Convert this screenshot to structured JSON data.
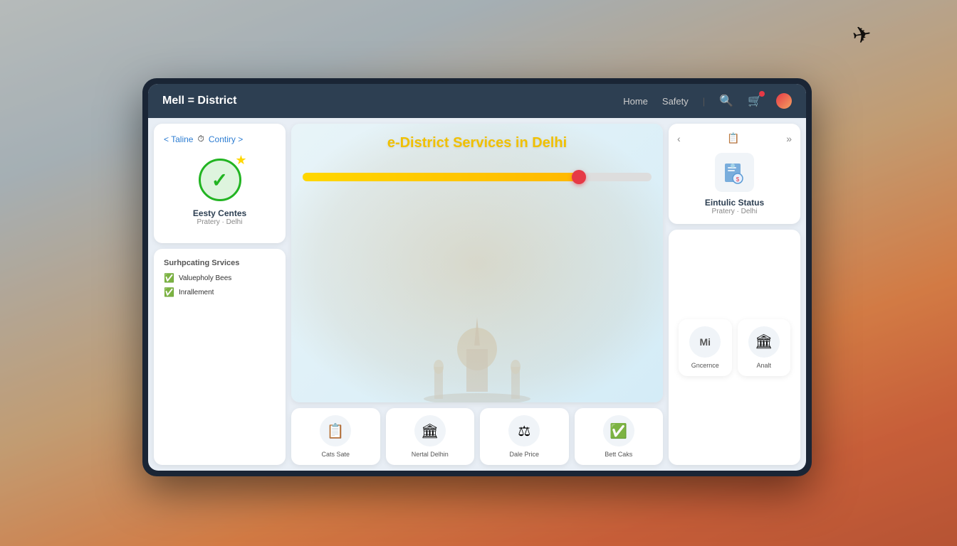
{
  "background": {
    "description": "Blurred Delhi monuments and city background with warm orange/red tones"
  },
  "airplane": "✈",
  "tablet": {
    "nav": {
      "logo": "Mell = District",
      "links": [
        "Home",
        "Safety"
      ],
      "icons": [
        "search",
        "notifications",
        "profile"
      ]
    },
    "left_panel": {
      "breadcrumb_back": "< Taline",
      "breadcrumb_icon": "⏱",
      "breadcrumb_forward": "Contiry >",
      "check_card": {
        "title": "Eesty Centes",
        "subtitle": "Pratery · Delhi"
      },
      "supporting": {
        "title": "Surhpcating Srvices",
        "items": [
          "Valuepholy Bees",
          "Inrallement"
        ]
      }
    },
    "center_panel": {
      "banner_title": "e-District Services in Delhi",
      "progress_percent": 80,
      "bottom_icons": [
        {
          "icon": "📋",
          "label": "Cats Sate"
        },
        {
          "icon": "🏛",
          "label": "Nertal Delhin"
        },
        {
          "icon": "⚖",
          "label": "Dale Price"
        },
        {
          "icon": "✅",
          "label": "Bett Caks"
        }
      ]
    },
    "right_panel": {
      "enroll_card": {
        "title": "Eintulic Status",
        "subtitle": "Pratery · Delhi"
      },
      "nav_icons": [
        "<",
        "📋",
        ">>"
      ]
    },
    "right_bottom_icons": [
      {
        "icon": "Mi",
        "label": "Gncernce"
      },
      {
        "icon": "🏛",
        "label": "Analt"
      }
    ]
  }
}
